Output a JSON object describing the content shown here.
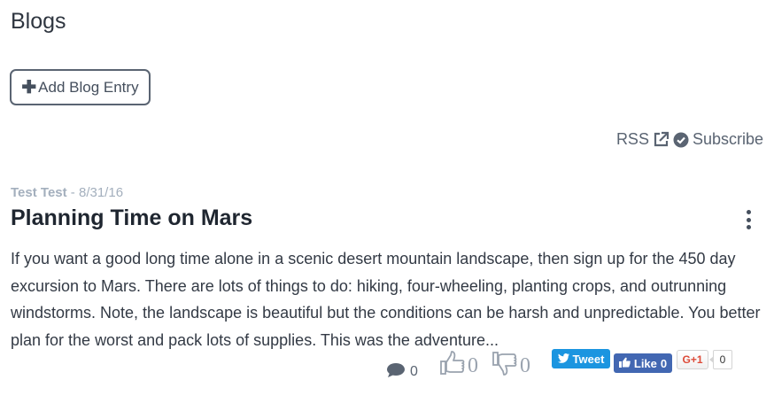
{
  "page": {
    "title": "Blogs"
  },
  "toolbar": {
    "add_label": "Add Blog Entry",
    "add_icon": "plus-icon"
  },
  "subscribe": {
    "rss_label": "RSS",
    "rss_icon": "external-link-icon",
    "subscribe_label": "Subscribe",
    "subscribe_icon": "check-circle-icon"
  },
  "post": {
    "author": "Test Test",
    "separator": " - ",
    "date": "8/31/16",
    "title": "Planning Time on Mars",
    "excerpt": "If you want a good long time alone in a scenic desert mountain landscape, then sign up for the 450 day excursion to Mars. There are lots of things to do: hiking, four-wheeling, planting crops, and outrunning windstorms. Note, the landscape is beautiful but the conditions can be harsh and unpredictable. You better plan for the worst and pack lots of supplies. This was the adventure...",
    "menu_icon": "kebab-menu-icon",
    "comments_count": "0",
    "likes_count": "0",
    "dislikes_count": "0"
  },
  "social": {
    "tweet_label": "Tweet",
    "like_label": "Like",
    "like_count": "0",
    "gplus_label": "G+1",
    "gplus_count": "0"
  },
  "colors": {
    "tweet": "#1b95e0",
    "facebook": "#4267b2",
    "gplus": "#dd4b39"
  }
}
